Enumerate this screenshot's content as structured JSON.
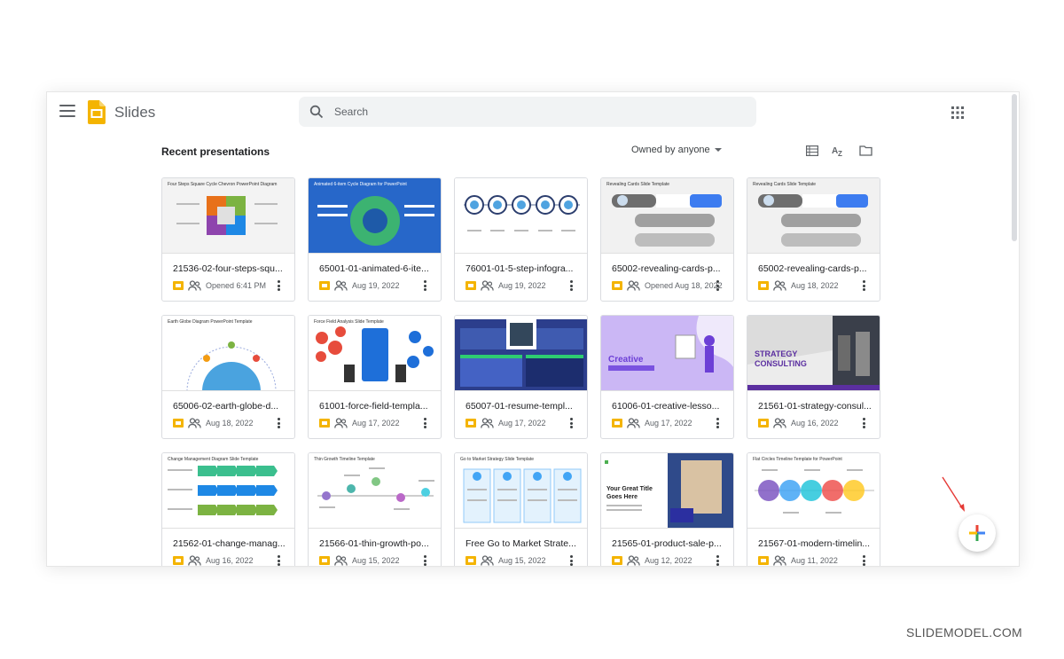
{
  "app": {
    "name": "Slides"
  },
  "search": {
    "placeholder": "Search"
  },
  "section": {
    "title": "Recent presentations",
    "owner_filter": "Owned by anyone"
  },
  "colors": {
    "slides_yellow": "#f4b400",
    "google_blue": "#4285f4",
    "google_red": "#ea4335",
    "google_yellow": "#fbbc04",
    "google_green": "#34a853",
    "arrow_red": "#e53935"
  },
  "icons": {
    "menu": "hamburger-icon",
    "search": "search-icon",
    "apps": "apps-grid-icon",
    "list_view": "list-view-icon",
    "sort": "sort-az-icon",
    "folder": "folder-icon",
    "new": "plus-icon"
  },
  "watermark": "SLIDEMODEL.COM",
  "cards": [
    {
      "name": "21536-02-four-steps-squ...",
      "date": "Opened 6:41 PM",
      "thumb_title": "Four Steps Square Cycle Chevron PowerPoint Diagram"
    },
    {
      "name": "65001-01-animated-6-ite...",
      "date": "Aug 19, 2022",
      "thumb_title": "Animated 6-item Cycle Diagram for PowerPoint"
    },
    {
      "name": "76001-01-5-step-infogra...",
      "date": "Aug 19, 2022",
      "thumb_title": ""
    },
    {
      "name": "65002-revealing-cards-p...",
      "date": "Opened Aug 18, 2022",
      "thumb_title": "Revealing Cards Slide Template"
    },
    {
      "name": "65002-revealing-cards-p...",
      "date": "Aug 18, 2022",
      "thumb_title": "Revealing Cards Slide Template"
    },
    {
      "name": "65006-02-earth-globe-d...",
      "date": "Aug 18, 2022",
      "thumb_title": "Earth Globe Diagram PowerPoint Template"
    },
    {
      "name": "61001-force-field-templa...",
      "date": "Aug 17, 2022",
      "thumb_title": "Force Field Analysis Slide Template"
    },
    {
      "name": "65007-01-resume-templ...",
      "date": "Aug 17, 2022",
      "thumb_title": ""
    },
    {
      "name": "61006-01-creative-lesso...",
      "date": "Aug 17, 2022",
      "thumb_title": "Creative"
    },
    {
      "name": "21561-01-strategy-consul...",
      "date": "Aug 16, 2022",
      "thumb_title": "STRATEGY CONSULTING"
    },
    {
      "name": "21562-01-change-manag...",
      "date": "Aug 16, 2022",
      "thumb_title": "Change Management Diagram Slide Template"
    },
    {
      "name": "21566-01-thin-growth-po...",
      "date": "Aug 15, 2022",
      "thumb_title": "Thin Growth Timeline Template"
    },
    {
      "name": "Free Go to Market Strate...",
      "date": "Aug 15, 2022",
      "thumb_title": "Go to Market Strategy Slide Template"
    },
    {
      "name": "21565-01-product-sale-p...",
      "date": "Aug 12, 2022",
      "thumb_title": "Your Great Title Goes Here"
    },
    {
      "name": "21567-01-modern-timelin...",
      "date": "Aug 11, 2022",
      "thumb_title": "Flat Circles Timeline Template for PowerPoint"
    }
  ]
}
